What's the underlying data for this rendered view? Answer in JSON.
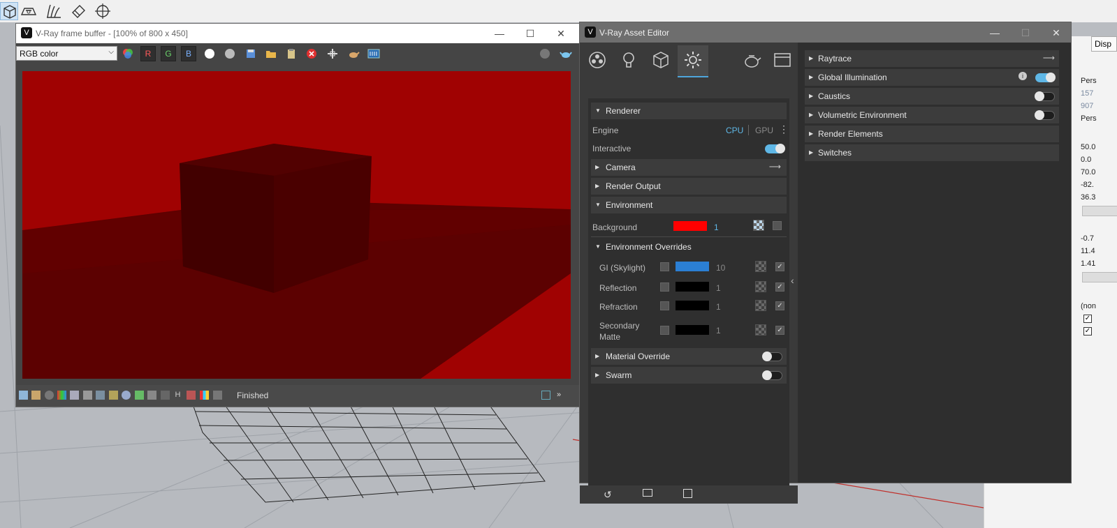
{
  "frame_buffer": {
    "title": "V-Ray frame buffer - [100% of 800 x 450]",
    "channel_select": "RGB color",
    "channel_buttons": [
      "R",
      "G",
      "B"
    ],
    "status": "Finished",
    "status_letter": "H"
  },
  "asset_editor": {
    "title": "V-Ray Asset Editor",
    "left_sections": {
      "renderer": "Renderer",
      "engine_label": "Engine",
      "engine_cpu": "CPU",
      "engine_gpu": "GPU",
      "interactive_label": "Interactive",
      "camera": "Camera",
      "render_output": "Render Output",
      "environment": "Environment",
      "background_label": "Background",
      "background_value": "1",
      "environment_overrides": "Environment Overrides",
      "gi_label": "GI (Skylight)",
      "gi_value": "10",
      "reflection_label": "Reflection",
      "reflection_value": "1",
      "refraction_label": "Refraction",
      "refraction_value": "1",
      "secondary_label_1": "Secondary",
      "secondary_label_2": "Matte",
      "secondary_value": "1",
      "material_override": "Material Override",
      "swarm": "Swarm"
    },
    "right_sections": [
      "Raytrace",
      "Global Illumination",
      "Caustics",
      "Volumetric Environment",
      "Render Elements",
      "Switches"
    ],
    "colors": {
      "background_swatch": "#ff0000",
      "gi_swatch": "#2b7fd4",
      "reflection_swatch": "#000000",
      "refraction_swatch": "#000000",
      "secondary_swatch": "#000000",
      "accent": "#5fb7e6"
    }
  },
  "properties_panel": {
    "tab_label": "Disp",
    "values": [
      "Pers",
      "157",
      "907",
      "Pers",
      "50.0",
      "0.0",
      "70.0",
      "-82.",
      "36.3",
      "-0.7",
      "11.4",
      "1.41",
      "(non"
    ]
  }
}
